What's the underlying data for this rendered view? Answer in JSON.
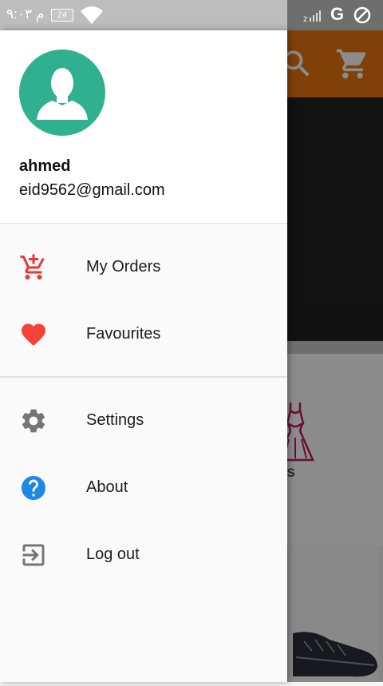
{
  "status_bar": {
    "time": "م ٩:٠٣",
    "battery": "24",
    "network": "G"
  },
  "drawer": {
    "user": {
      "name": "ahmed",
      "email": "eid9562@gmail.com"
    },
    "menu": [
      {
        "label": "My Orders",
        "icon": "cart-plus-icon",
        "color": "#e53935"
      },
      {
        "label": "Favourites",
        "icon": "heart-icon",
        "color": "#f44336"
      },
      {
        "label": "Settings",
        "icon": "gear-icon",
        "color": "#757575"
      },
      {
        "label": "About",
        "icon": "help-circle-icon",
        "color": "#1e88e5"
      },
      {
        "label": "Log out",
        "icon": "logout-icon",
        "color": "#757575"
      }
    ]
  },
  "background": {
    "category_label": "ress",
    "app_bar_color": "#e9750f"
  }
}
